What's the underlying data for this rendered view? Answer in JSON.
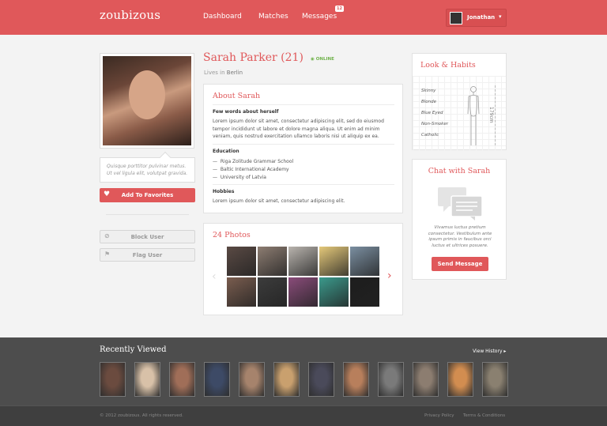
{
  "header": {
    "logo": "zoubizous",
    "nav": [
      "Dashboard",
      "Matches",
      "Messages"
    ],
    "message_count": "12",
    "user": "Jonathan"
  },
  "profile": {
    "name": "Sarah Parker (21)",
    "status": "ONLINE",
    "lives_prefix": "Lives in",
    "city": "Berlin",
    "quote": "Quisque porttitor pulvinar metus. Ut vel ligula elit, volutpat gravida.",
    "favorite_label": "Add To Favorites",
    "block_label": "Block User",
    "flag_label": "Flag User"
  },
  "about": {
    "title": "About Sarah",
    "few_words_heading": "Few words about herself",
    "few_words": "Lorem ipsum dolor sit amet, consectetur adipiscing elit, sed do eiusmod tempor incididunt ut labore et dolore magna aliqua. Ut enim ad minim veniam, quis nostrud exercitation ullamco laboris nisi ut aliquip ex ea.",
    "education_heading": "Education",
    "education": [
      "Riga Zolitude Grammar School",
      "Baltic International Academy",
      "University of Latvia"
    ],
    "hobbies_heading": "Hobbies",
    "hobbies": "Lorem ipsum dolor sit amet, consectetur adipiscing elit."
  },
  "photos": {
    "title": "24 Photos",
    "thumb_colors": [
      "#5a4a44",
      "#8d7d72",
      "#b9b4ae",
      "#e5c97a",
      "#7b8fa1",
      "#7a5d4f",
      "#3c3c3c",
      "#8a4c7a",
      "#3b9a8c",
      "#1d1d1d"
    ]
  },
  "look": {
    "title": "Look & Habits",
    "items": [
      "Skinny",
      "Blonde",
      "Blue Eyed",
      "Non-Smoker",
      "Catholic"
    ],
    "height": "179cm"
  },
  "chat": {
    "title": "Chat with Sarah",
    "text": "Vivamus luctus pretium consectetur. Vestibulum ante ipsum primis in faucibus orci luctus et ultrices posuere.",
    "button": "Send Message"
  },
  "recent": {
    "title": "Recently Viewed",
    "view_history": "View History",
    "thumb_colors": [
      "#6b4b3f",
      "#d8c1a8",
      "#a06e58",
      "#3d4a66",
      "#a6836c",
      "#c9a06e",
      "#4a4a5a",
      "#b87f5c",
      "#7a7a7a",
      "#8c7d70",
      "#d28d50",
      "#8a8070"
    ]
  },
  "footer": {
    "copyright": "© 2012 zoubizous. All rights reserved.",
    "privacy": "Privacy Policy",
    "terms": "Terms & Conditions"
  }
}
